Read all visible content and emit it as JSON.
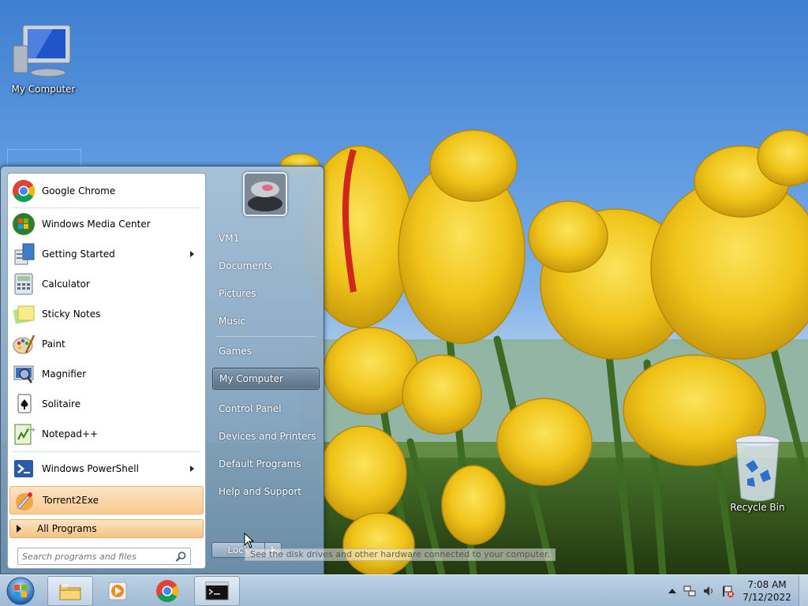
{
  "desktop": {
    "icons": [
      {
        "label": "My Computer"
      },
      {
        "label": "Recycle Bin"
      }
    ]
  },
  "start_menu": {
    "programs": [
      {
        "label": "Google Chrome",
        "icon": "chrome-icon"
      },
      {
        "label": "Windows Media Center",
        "icon": "windows-logo-icon"
      },
      {
        "label": "Getting Started",
        "icon": "getting-started-icon",
        "submenu": true
      },
      {
        "label": "Calculator",
        "icon": "calculator-icon"
      },
      {
        "label": "Sticky Notes",
        "icon": "sticky-notes-icon"
      },
      {
        "label": "Paint",
        "icon": "paint-palette-icon"
      },
      {
        "label": "Magnifier",
        "icon": "magnifier-icon"
      },
      {
        "label": "Solitaire",
        "icon": "card-icon"
      },
      {
        "label": "Notepad++",
        "icon": "notepad-plus-icon"
      },
      {
        "label": "Windows PowerShell",
        "icon": "powershell-icon",
        "submenu": true
      },
      {
        "label": "Torrent2Exe",
        "icon": "torrent2exe-icon"
      }
    ],
    "all_programs_label": "All Programs",
    "search_placeholder": "Search programs and files",
    "places": [
      {
        "label": "VM1"
      },
      {
        "label": "Documents"
      },
      {
        "label": "Pictures"
      },
      {
        "label": "Music"
      },
      {
        "label": "Games"
      },
      {
        "label": "My Computer"
      },
      {
        "label": "Control Panel"
      },
      {
        "label": "Devices and Printers"
      },
      {
        "label": "Default Programs"
      },
      {
        "label": "Help and Support"
      }
    ],
    "lock_label": "Lock",
    "tooltip": "See the disk drives and other hardware connected to your computer."
  },
  "taskbar": {
    "pinned": [
      "explorer-folder-icon",
      "media-player-icon",
      "chrome-icon",
      "cmd-icon"
    ],
    "clock_time": "7:08 AM",
    "clock_date": "7/12/2022"
  },
  "colors": {
    "sky": "#4a86d3",
    "tulip": "#f2c81e",
    "highlight": "#f8c98f"
  }
}
